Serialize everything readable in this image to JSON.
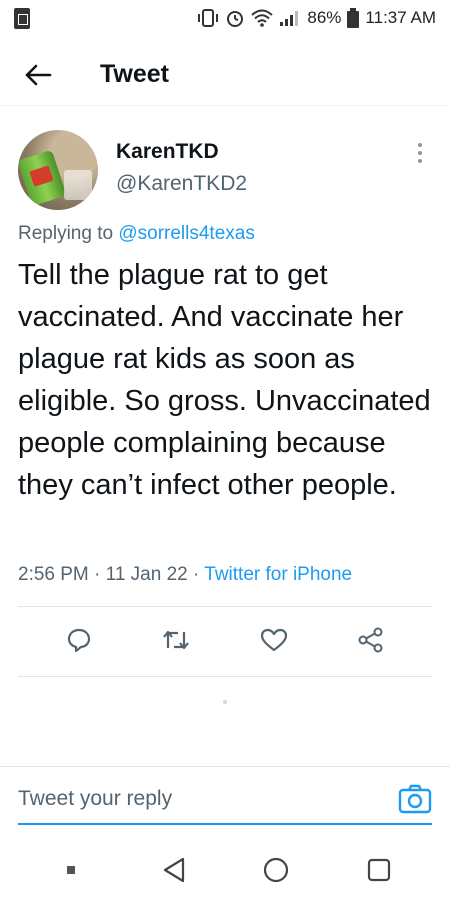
{
  "status_bar": {
    "battery": "86%",
    "time": "11:37 AM"
  },
  "header": {
    "title": "Tweet"
  },
  "tweet": {
    "display_name": "KarenTKD",
    "handle": "@KarenTKD2",
    "replying_prefix": "Replying to ",
    "replying_to": "@sorrells4texas",
    "text": "Tell the plague rat to get vaccinated. And vaccinate her plague rat kids as soon as eligible. So gross. Unvaccinated people complaining because they can’t infect other people.",
    "time": "2:56 PM",
    "sep1": " · ",
    "date": "11 Jan 22",
    "sep2": " · ",
    "source": "Twitter for iPhone"
  },
  "reply": {
    "placeholder": "Tweet your reply"
  },
  "colors": {
    "accent": "#1d9bf0",
    "secondary_text": "#536471",
    "primary_text": "#0f1419"
  },
  "icons": {
    "back": "arrow-left-icon",
    "more": "more-vertical-icon",
    "reply": "reply-icon",
    "retweet": "retweet-icon",
    "like": "heart-icon",
    "share": "share-icon",
    "camera": "camera-icon"
  }
}
